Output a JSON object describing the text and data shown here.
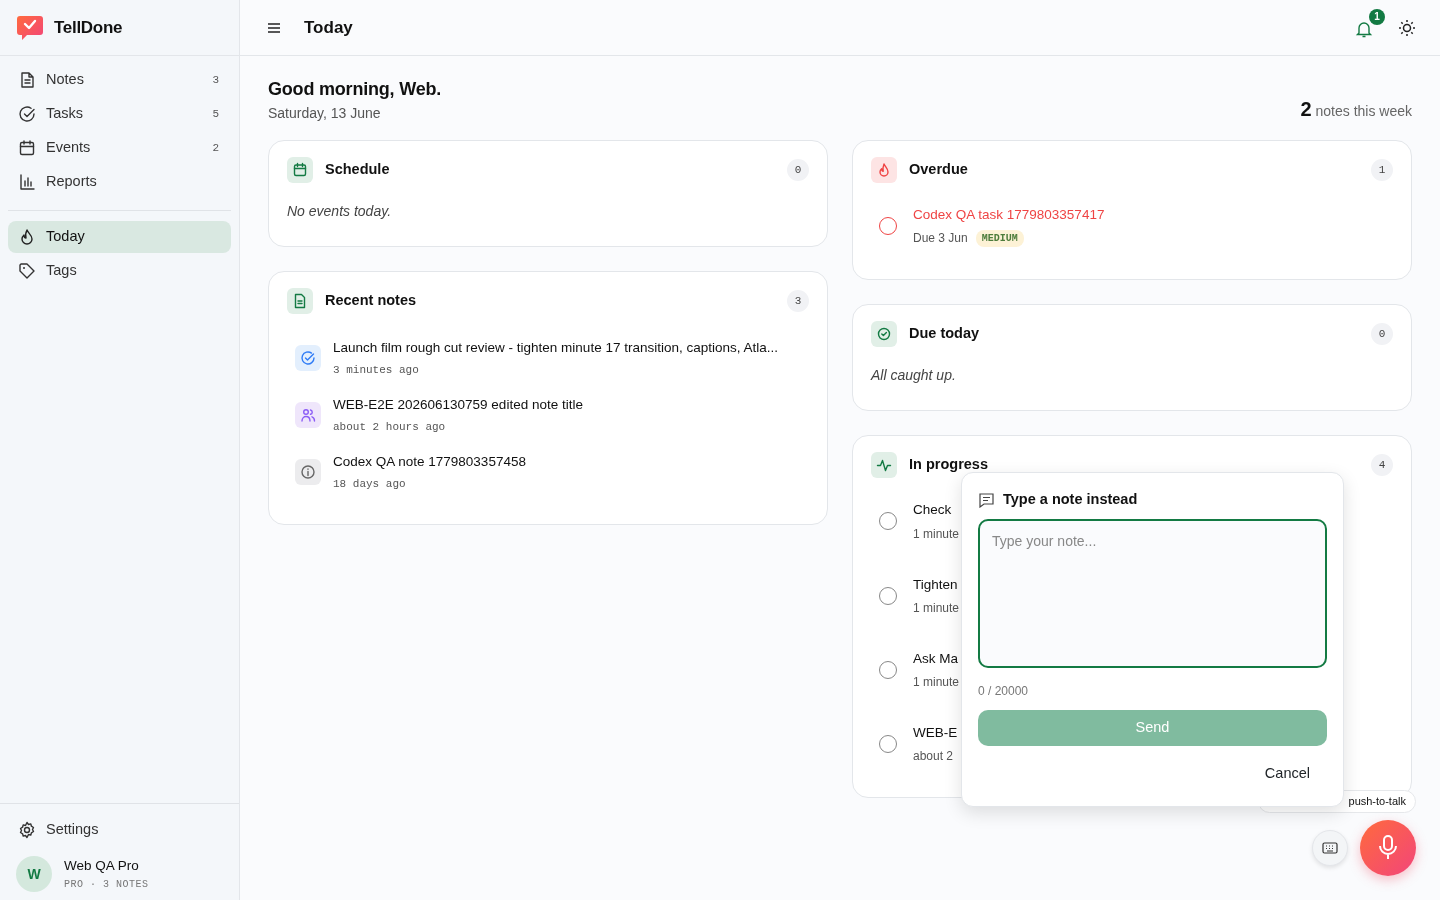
{
  "app": {
    "name": "TellDone"
  },
  "sidebar": {
    "items": [
      {
        "label": "Notes",
        "count": "3",
        "selected": false
      },
      {
        "label": "Tasks",
        "count": "5",
        "selected": false
      },
      {
        "label": "Events",
        "count": "2",
        "selected": false
      },
      {
        "label": "Reports",
        "selected": false
      }
    ],
    "secondary": [
      {
        "label": "Today",
        "selected": true
      },
      {
        "label": "Tags",
        "selected": false
      }
    ],
    "settings": "Settings",
    "user": {
      "initial": "W",
      "name": "Web QA Pro",
      "meta": "PRO · 3 NOTES"
    }
  },
  "header": {
    "title": "Today",
    "notification_count": "1"
  },
  "greeting": {
    "title": "Good morning, Web.",
    "date": "Saturday, 13 June",
    "stat_value": "2",
    "stat_label": "notes this week"
  },
  "schedule": {
    "title": "Schedule",
    "count": "0",
    "empty": "No events today."
  },
  "recent_notes": {
    "title": "Recent notes",
    "count": "3",
    "items": [
      {
        "kind": "task",
        "title": "Launch film rough cut review - tighten minute 17 transition, captions, Atla...",
        "time": "3 minutes ago"
      },
      {
        "kind": "people",
        "title": "WEB-E2E 202606130759 edited note title",
        "time": "about 2 hours ago"
      },
      {
        "kind": "info",
        "title": "Codex QA note 1779803357458",
        "time": "18 days ago"
      }
    ]
  },
  "overdue": {
    "title": "Overdue",
    "count": "1",
    "items": [
      {
        "title": "Codex QA task 1779803357417",
        "due": "Due 3 Jun",
        "priority": "MEDIUM",
        "overdue": true,
        "checked": false
      }
    ]
  },
  "due_today": {
    "title": "Due today",
    "count": "0",
    "empty": "All caught up."
  },
  "in_progress": {
    "title": "In progress",
    "count": "4",
    "items": [
      {
        "title": "Check",
        "meta": "1 minute",
        "overdue": false,
        "checked": false
      },
      {
        "title": "Tighten",
        "meta": "1 minute",
        "overdue": false,
        "checked": false
      },
      {
        "title": "Ask Ma",
        "meta": "1 minute",
        "overdue": false,
        "checked": false
      },
      {
        "title": "WEB-E",
        "meta": "about 2",
        "overdue": false,
        "checked": false
      }
    ]
  },
  "note_popover": {
    "title": "Type a note instead",
    "placeholder": "Type your note...",
    "counter": "0 / 20000",
    "send": "Send",
    "cancel": "Cancel"
  },
  "record_hint": "push-to-talk"
}
